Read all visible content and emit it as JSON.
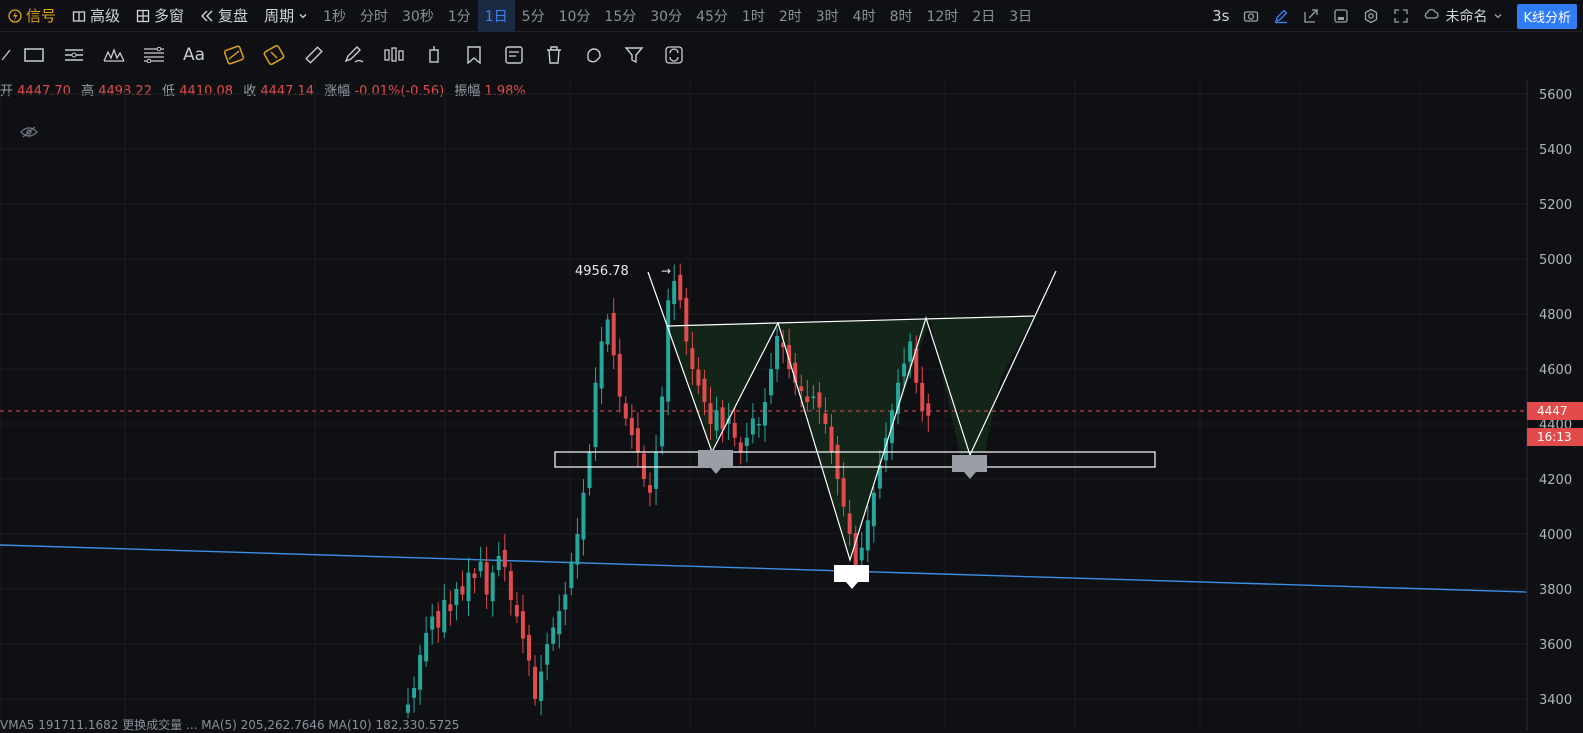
{
  "topbar": {
    "signal_label": "信号",
    "advanced_label": "高级",
    "multiwindow_label": "多窗",
    "replay_label": "复盘",
    "period_label": "周期",
    "periods": [
      "1秒",
      "分时",
      "30秒",
      "1分",
      "1日",
      "5分",
      "10分",
      "15分",
      "30分",
      "45分",
      "1时",
      "2时",
      "3时",
      "4时",
      "8时",
      "12时",
      "2日",
      "3日"
    ],
    "active_period": "1日",
    "refresh_label": "3s",
    "layout_name": "未命名",
    "kline_button": "K线分析"
  },
  "ohlc": {
    "open_label": "开",
    "open": "4447.70",
    "high_label": "高",
    "high": "4498.22",
    "low_label": "低",
    "low": "4410.08",
    "close_label": "收",
    "close": "4447.14",
    "change_label": "涨幅",
    "change": "-0.01%(-0.56)",
    "amplitude_label": "振幅",
    "amplitude": "1.98%"
  },
  "chart_data": {
    "type": "candlestick",
    "y_ticks": [
      "5600",
      "5400",
      "5200",
      "5000",
      "4800",
      "4600",
      "4400",
      "4200",
      "4000",
      "3800",
      "3600",
      "3400"
    ],
    "current_price_label": "4447",
    "countdown_label": "16:13",
    "peak_annotation": "4956.78",
    "colors": {
      "up": "#26a69a",
      "down": "#e14b4b",
      "trendline": "#3b8ee8",
      "pattern": "#ffffff",
      "pattern_fill": "#1b3a1f"
    }
  },
  "bottom_indicator_text": "VMA5 191711.1682  更换成交量  ...  MA(5) 205,262.7646  MA(10) 182,330.5725"
}
